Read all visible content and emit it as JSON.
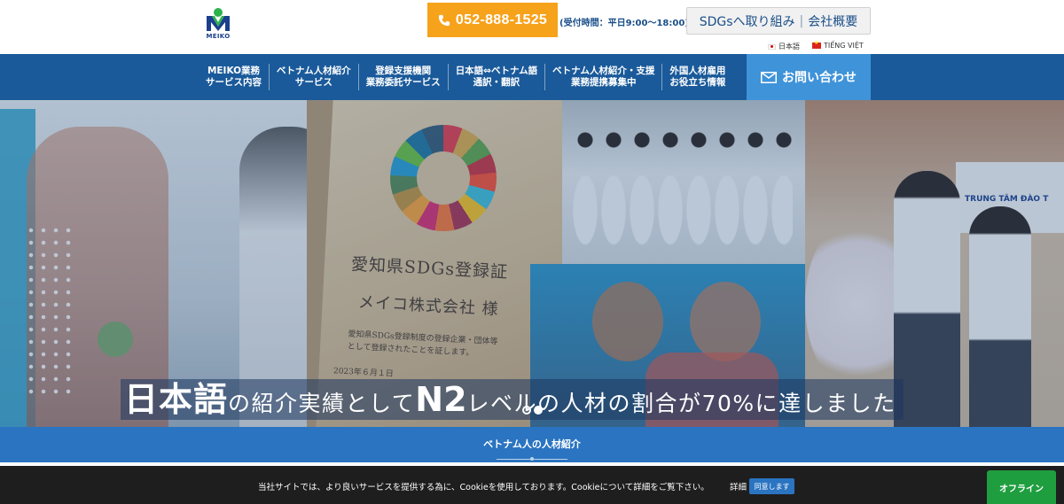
{
  "header": {
    "logo_text": "MEIKO",
    "phone": "052-888-1525",
    "phone_hours": "(受付時間：平日9:00〜18:00)",
    "sdgs_link": "SDGsへ取り組み",
    "company_link": "会社概要",
    "lang_jp": "日本語",
    "lang_vn": "TIẾNG VIỆT"
  },
  "nav": {
    "items": [
      {
        "label": "MEIKO業務\nサービス内容"
      },
      {
        "label": "ベトナム人材紹介\nサービス"
      },
      {
        "label": "登録支援機関\n業務委託サービス"
      },
      {
        "label": "日本語⇔ベトナム語\n通訳・翻訳"
      },
      {
        "label": "ベトナム人材紹介・支援\n業務提携募集中"
      },
      {
        "label": "外国人材雇用\nお役立ち情報"
      }
    ],
    "contact": "お問い合わせ"
  },
  "hero": {
    "board_title": "愛知県SDGs登録証",
    "board_company": "メイコ株式会社 様",
    "board_body_1": "愛知県SDGs登録制度の登録企業・団体等",
    "board_body_2": "として登録されたことを証します。",
    "board_date": "2023年６月１日",
    "sign_text": "TRUNG TÂM ĐÀO T",
    "caption_1": "日本語",
    "caption_2": "の紹介実績として",
    "caption_3": "N2",
    "caption_4": "レベルの人材の割合が70%に達しました",
    "slides_total": 2,
    "slide_active": 2
  },
  "section": {
    "title": "ベトナム人の人材紹介"
  },
  "cookie": {
    "text": "当社サイトでは、より良いサービスを提供する為に、Cookieを使用しております。Cookieについて詳細をご覧下さい。",
    "details": "詳細",
    "agree": "同意します"
  },
  "chat": {
    "status": "オフライン"
  },
  "colors": {
    "brand_blue": "#1a5a9a",
    "accent_orange": "#f7a21b",
    "contact_blue": "#3f93d9",
    "section_blue": "#2a74c1",
    "online_green": "#1f9e3f"
  }
}
